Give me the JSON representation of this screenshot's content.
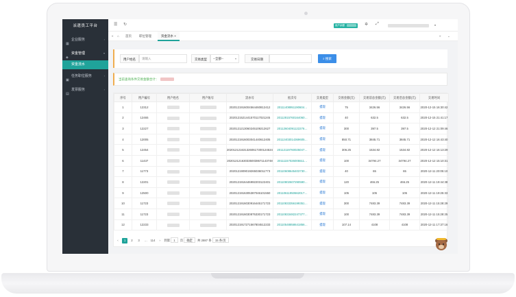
{
  "sidebar": {
    "brand": "派遣员工平台",
    "items": [
      {
        "label": "企业服务",
        "icon": "building-icon"
      },
      {
        "label": "资金管理",
        "icon": "money-icon"
      },
      {
        "label": "任务职位服务",
        "icon": "briefcase-icon"
      },
      {
        "label": "发票服务",
        "icon": "receipt-icon"
      }
    ],
    "active_sub": "资金流水"
  },
  "topbar": {
    "user_badge": "用户余额",
    "icons": [
      "menu-icon",
      "refresh-icon",
      "bell-icon",
      "fullscreen-icon"
    ]
  },
  "tabs": [
    {
      "label": "首页"
    },
    {
      "label": "职位管理"
    },
    {
      "label": "资金流水",
      "active": true
    }
  ],
  "search": {
    "user_label": "用户姓名",
    "user_placeholder": "请输入",
    "type_label": "交易类型",
    "type_value": "--全部--",
    "date_label": "交易日期",
    "button": "搜索"
  },
  "summary": {
    "text": "当前查询条件交易金额合计："
  },
  "table": {
    "columns": [
      "序号",
      "用户编号",
      "用户姓名",
      "用户账号",
      "流水号",
      "批次号",
      "交易类型",
      "交易金额(元)",
      "交易前总金额(元)",
      "交易后总金额(元)",
      "交易时间"
    ],
    "rows": [
      [
        "1",
        "12312",
        "",
        "",
        "2020121916004564460812412",
        "20111408951190604…",
        "提现",
        "75",
        "3426.56",
        "3426.56",
        "2020-12-15 16:30:42"
      ],
      [
        "2",
        "12465",
        "",
        "",
        "2020121521441570117021245",
        "20112815760164060…",
        "提现",
        "40",
        "632.5",
        "632.5",
        "2020-12-15 21:41:17"
      ],
      [
        "3",
        "12227",
        "",
        "",
        "2020121213060245109212627",
        "20112604091122276…",
        "提现",
        "300",
        "397.5",
        "397.5",
        "2020-12-12 21:09:46"
      ],
      [
        "4",
        "12005",
        "",
        "",
        "2020121916003041440612405",
        "20112403014369605…",
        "提现",
        "850.71",
        "3845.71",
        "3845.71",
        "2020-12-12 16:43:40"
      ],
      [
        "5",
        "12454",
        "",
        "",
        "2020121216313260617300124534",
        "20112119760025047…",
        "提现",
        "306.25",
        "1534.82",
        "1534.82",
        "2020-12-12 16:13:29"
      ],
      [
        "6",
        "11437",
        "",
        "",
        "2020121216303350038671143748",
        "20111157026005511…",
        "提现",
        "100",
        "34794.27",
        "34794.27",
        "2020-12-12 15:10:31"
      ],
      [
        "7",
        "11773",
        "",
        "",
        "2020121909019265036011773",
        "20110608645403730…",
        "提现",
        "40",
        "65",
        "65",
        "2020-12-11 20:05:10"
      ],
      [
        "8",
        "12201",
        "",
        "",
        "2020121916446992203122401",
        "20110802607290590…",
        "提现",
        "120",
        "466.25",
        "466.25",
        "2020-12-11 19:44:38"
      ],
      [
        "9",
        "12500",
        "",
        "",
        "2020121916305387046101550",
        "20110611950662017…",
        "提现",
        "105",
        "105",
        "105",
        "2020-12-11 19:25:33"
      ],
      [
        "10",
        "11723",
        "",
        "",
        "2020121916030916445171723",
        "20110833356199351…",
        "提现",
        "300",
        "7483.39",
        "7483.39",
        "2020-12-11 15:28:29"
      ],
      [
        "11",
        "11723",
        "",
        "",
        "2020121916030875330171723",
        "20110833482247377…",
        "提现",
        "100",
        "7483.39",
        "7483.39",
        "2020-12-11 15:28:25"
      ],
      [
        "12",
        "12233",
        "",
        "",
        "2020121917271567804512233",
        "20110548858641856…",
        "提现",
        "107.14",
        "4108",
        "4108",
        "2020-12-11 17:37:16"
      ]
    ]
  },
  "pager": {
    "pages": [
      "1",
      "2",
      "3",
      "…",
      "114"
    ],
    "goto_label": "到第",
    "goto_value": "1",
    "page_unit": "页",
    "confirm": "确定",
    "total": "共 2887 条",
    "page_size": "15 条/页"
  }
}
